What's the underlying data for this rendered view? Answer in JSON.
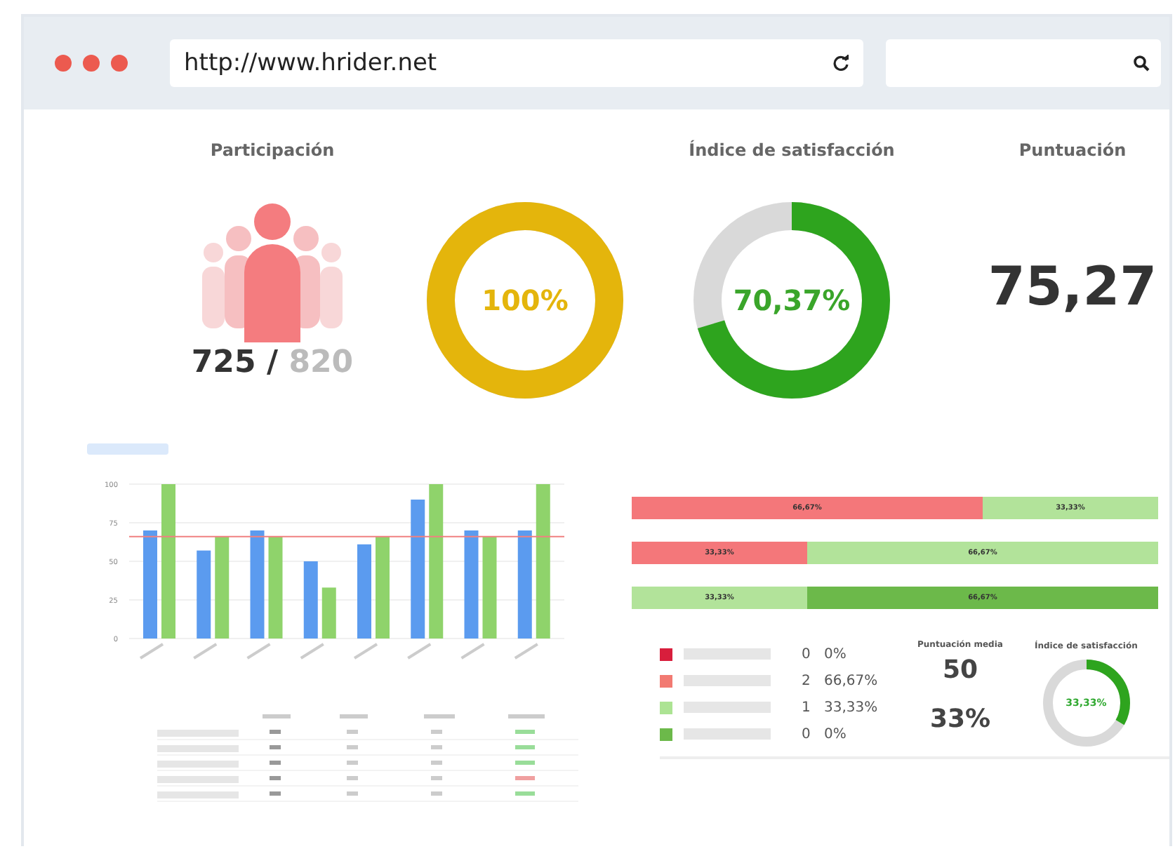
{
  "browser": {
    "url": "http://www.hrider.net"
  },
  "participation": {
    "title": "Participación",
    "value": "725",
    "separator": "/",
    "total": "820"
  },
  "participation_gauge": {
    "label": "100%"
  },
  "satisfaction": {
    "title": "Índice de satisfacción",
    "label": "70,37%"
  },
  "score": {
    "title": "Puntuación",
    "value": "75,27"
  },
  "bar_chart": {
    "chart_data": {
      "type": "bar",
      "grid": true,
      "ylim": [
        0,
        100
      ],
      "yticks": [
        0,
        25,
        50,
        75,
        100
      ],
      "ref_lines": [
        {
          "axis": "y",
          "value": 66,
          "color": "#f08080"
        }
      ],
      "series": [
        {
          "color": "#5b9bef",
          "values": [
            70,
            57,
            70,
            50,
            61,
            90,
            70,
            70
          ]
        },
        {
          "color": "#8fd36b",
          "values": [
            100,
            66,
            66,
            33,
            66,
            100,
            66,
            100
          ]
        }
      ]
    }
  },
  "stacked_bars": [
    {
      "segments": [
        {
          "label": "66,67%",
          "color": "#f4777a"
        },
        {
          "label": "33,33%",
          "color": "#b2e39a"
        }
      ]
    },
    {
      "segments": [
        {
          "label": "33,33%",
          "color": "#f4777a"
        },
        {
          "label": "66,67%",
          "color": "#b2e39a"
        }
      ]
    },
    {
      "segments": [
        {
          "label": "33,33%",
          "color": "#b2e39a"
        },
        {
          "label": "66,67%",
          "color": "#6cb94a"
        }
      ]
    }
  ],
  "distribution": [
    {
      "color": "#d81e3c",
      "count": "0",
      "percent": "0%"
    },
    {
      "color": "#f27a72",
      "count": "2",
      "percent": "66,67%"
    },
    {
      "color": "#ace393",
      "count": "1",
      "percent": "33,33%"
    },
    {
      "color": "#6cb94a",
      "count": "0",
      "percent": "0%"
    }
  ],
  "summary": {
    "mean_title": "Puntuación media",
    "mean": "50",
    "pass": "33%",
    "gauge_title": "Índice de satisfacción",
    "gauge_label": "33,33%"
  }
}
